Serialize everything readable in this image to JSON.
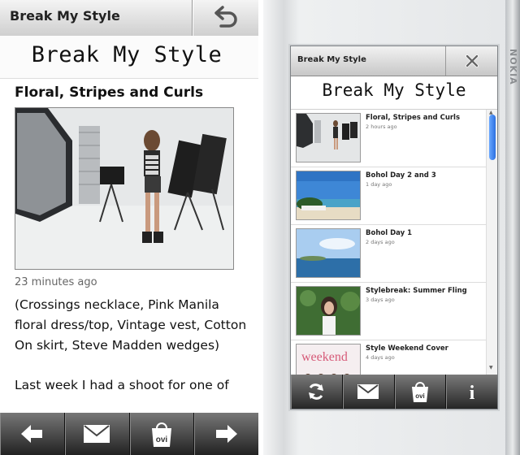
{
  "left": {
    "app_title": "Break My Style",
    "banner": "Break My Style",
    "article": {
      "title": "Floral, Stripes and Curls",
      "time_ago": "23 minutes ago",
      "body": "(Crossings necklace, Pink Manila floral dress/top, Vintage vest, Cotton On skirt, Steve Madden wedges)",
      "body_continued": "Last week I had a shoot for one of"
    },
    "toolbar": {
      "icons": [
        "back-arrow-icon",
        "mail-icon",
        "ovi-store-icon",
        "forward-arrow-icon"
      ],
      "ovi_label": "ovi"
    }
  },
  "right": {
    "app_title": "Break My Style",
    "banner": "Break My Style",
    "brand": "NOKIA",
    "items": [
      {
        "title": "Floral, Stripes and Curls",
        "ago": "2 hours ago"
      },
      {
        "title": "Bohol Day 2 and 3",
        "ago": "1 day ago"
      },
      {
        "title": "Bohol Day 1",
        "ago": "2 days ago"
      },
      {
        "title": "Stylebreak: Summer Fling",
        "ago": "3 days ago"
      },
      {
        "title": "Style Weekend Cover",
        "ago": "4 days ago"
      }
    ],
    "toolbar": {
      "icons": [
        "refresh-icon",
        "mail-icon",
        "ovi-store-icon",
        "info-icon"
      ],
      "ovi_label": "ovi",
      "info_label": "i"
    }
  }
}
